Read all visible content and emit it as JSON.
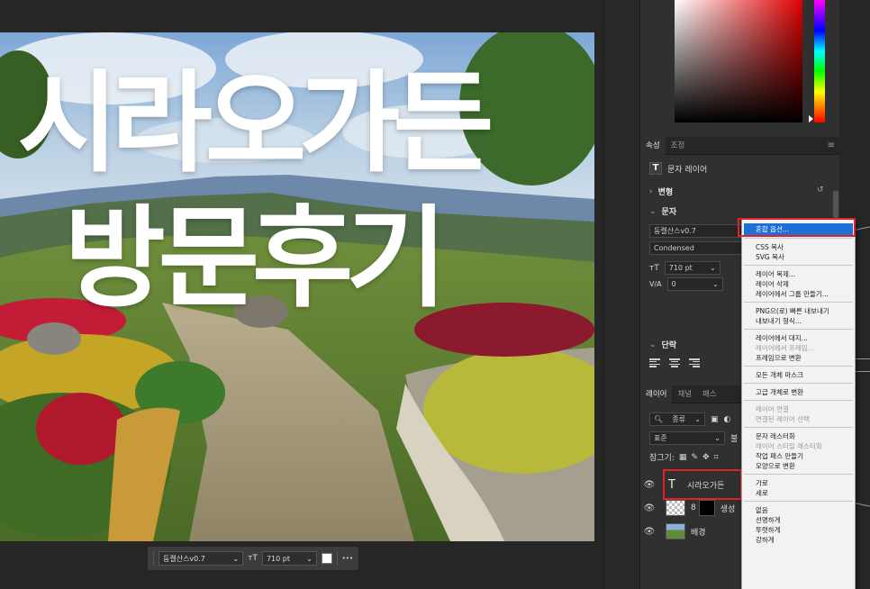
{
  "artwork": {
    "hero_line_1": "시라오가든",
    "hero_line_2": "방문후기"
  },
  "text_toolbar": {
    "font": "둥켈산스v0.7",
    "size": "710 pt",
    "more": "•••",
    "size_icon": "font-size-icon"
  },
  "properties_panel": {
    "tabs": [
      {
        "label": "속성",
        "active": true
      },
      {
        "label": "조정",
        "active": false
      }
    ],
    "layer_kind": "문자 레이어",
    "transform_title": "변형",
    "text_title": "문자",
    "font_family": "둥켈산스v0.7",
    "font_style": "Condensed",
    "font_size": "710 pt",
    "tracking": "0",
    "tracking_label": "V/A",
    "paragraph_title": "단락"
  },
  "layers_panel": {
    "tabs": [
      {
        "label": "레이어",
        "active": true
      },
      {
        "label": "채널",
        "active": false
      },
      {
        "label": "패스",
        "active": false
      }
    ],
    "filter_kind": "종류",
    "blend_mode": "표준",
    "opacity_label": "불",
    "lock_label": "잠그기:",
    "layers": [
      {
        "name": "시라오가든",
        "type": "text"
      },
      {
        "name": "생성",
        "type": "smart"
      },
      {
        "name": "배경",
        "type": "image"
      }
    ]
  },
  "context_menu": {
    "items": [
      {
        "label": "혼합 옵션...",
        "state": "highlight"
      },
      {
        "sep": true
      },
      {
        "label": "CSS 복사"
      },
      {
        "label": "SVG 복사"
      },
      {
        "sep": true
      },
      {
        "label": "레이어 복제..."
      },
      {
        "label": "레이어 삭제"
      },
      {
        "label": "레이어에서 그룹 만들기..."
      },
      {
        "sep": true
      },
      {
        "label": "PNG으(로) 빠른 내보내기"
      },
      {
        "label": "내보내기 형식..."
      },
      {
        "sep": true
      },
      {
        "label": "레이어에서 대지..."
      },
      {
        "label": "레이어에서 프레임...",
        "state": "disabled"
      },
      {
        "label": "프레임으로 변환"
      },
      {
        "sep": true
      },
      {
        "label": "모든 개체 마스크"
      },
      {
        "sep": true
      },
      {
        "label": "고급 개체로 변환"
      },
      {
        "sep": true
      },
      {
        "label": "레이어 연결",
        "state": "disabled"
      },
      {
        "label": "연결된 레이어 선택",
        "state": "disabled"
      },
      {
        "sep": true
      },
      {
        "label": "문자 래스터화"
      },
      {
        "label": "레이어 스타일 래스터화",
        "state": "disabled"
      },
      {
        "label": "작업 패스 만들기"
      },
      {
        "label": "모양으로 변환"
      },
      {
        "sep": true
      },
      {
        "label": "가로"
      },
      {
        "label": "세로"
      },
      {
        "sep": true
      },
      {
        "label": "없음"
      },
      {
        "label": "선명하게"
      },
      {
        "label": "뚜렷하게"
      },
      {
        "label": "강하게"
      }
    ]
  },
  "colors": {
    "highlight": "#1e6fd6",
    "annotation_red": "#e0202b",
    "panel_bg": "#303030"
  }
}
